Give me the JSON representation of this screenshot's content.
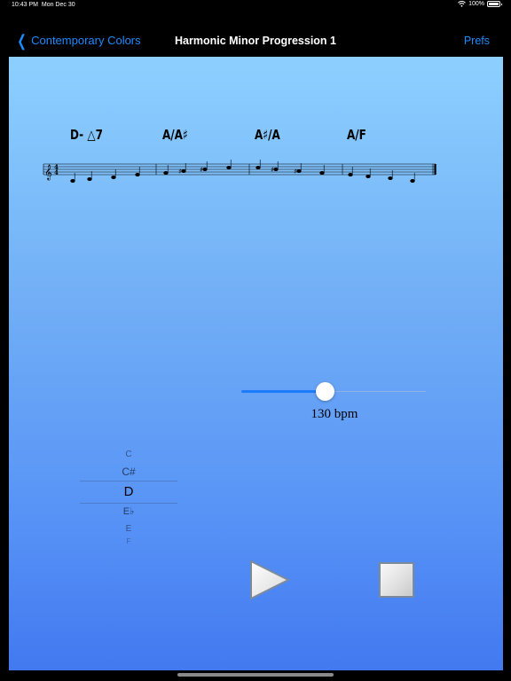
{
  "status_bar": {
    "time": "10:43 PM",
    "date": "Mon Dec 30",
    "battery": "100%",
    "wifi_icon": "wifi-icon"
  },
  "nav": {
    "back_label": "Contemporary Colors",
    "title": "Harmonic Minor Progression 1",
    "prefs_label": "Prefs"
  },
  "score": {
    "chords": [
      "D- △7",
      "A/A♯",
      "A♯/A",
      "A/F"
    ],
    "time_signature": [
      "4",
      "4"
    ]
  },
  "tempo": {
    "value": 130,
    "min": 40,
    "max": 240,
    "label": "130 bpm"
  },
  "key_picker": {
    "options": [
      "C",
      "C#",
      "D",
      "E♭",
      "E",
      "F"
    ],
    "selected": "D"
  },
  "controls": {
    "play_icon": "play-icon",
    "stop_icon": "stop-icon"
  },
  "colors": {
    "accent": "#1e8bff",
    "background_top": "#8dd0ff",
    "background_bottom": "#4279f0"
  }
}
